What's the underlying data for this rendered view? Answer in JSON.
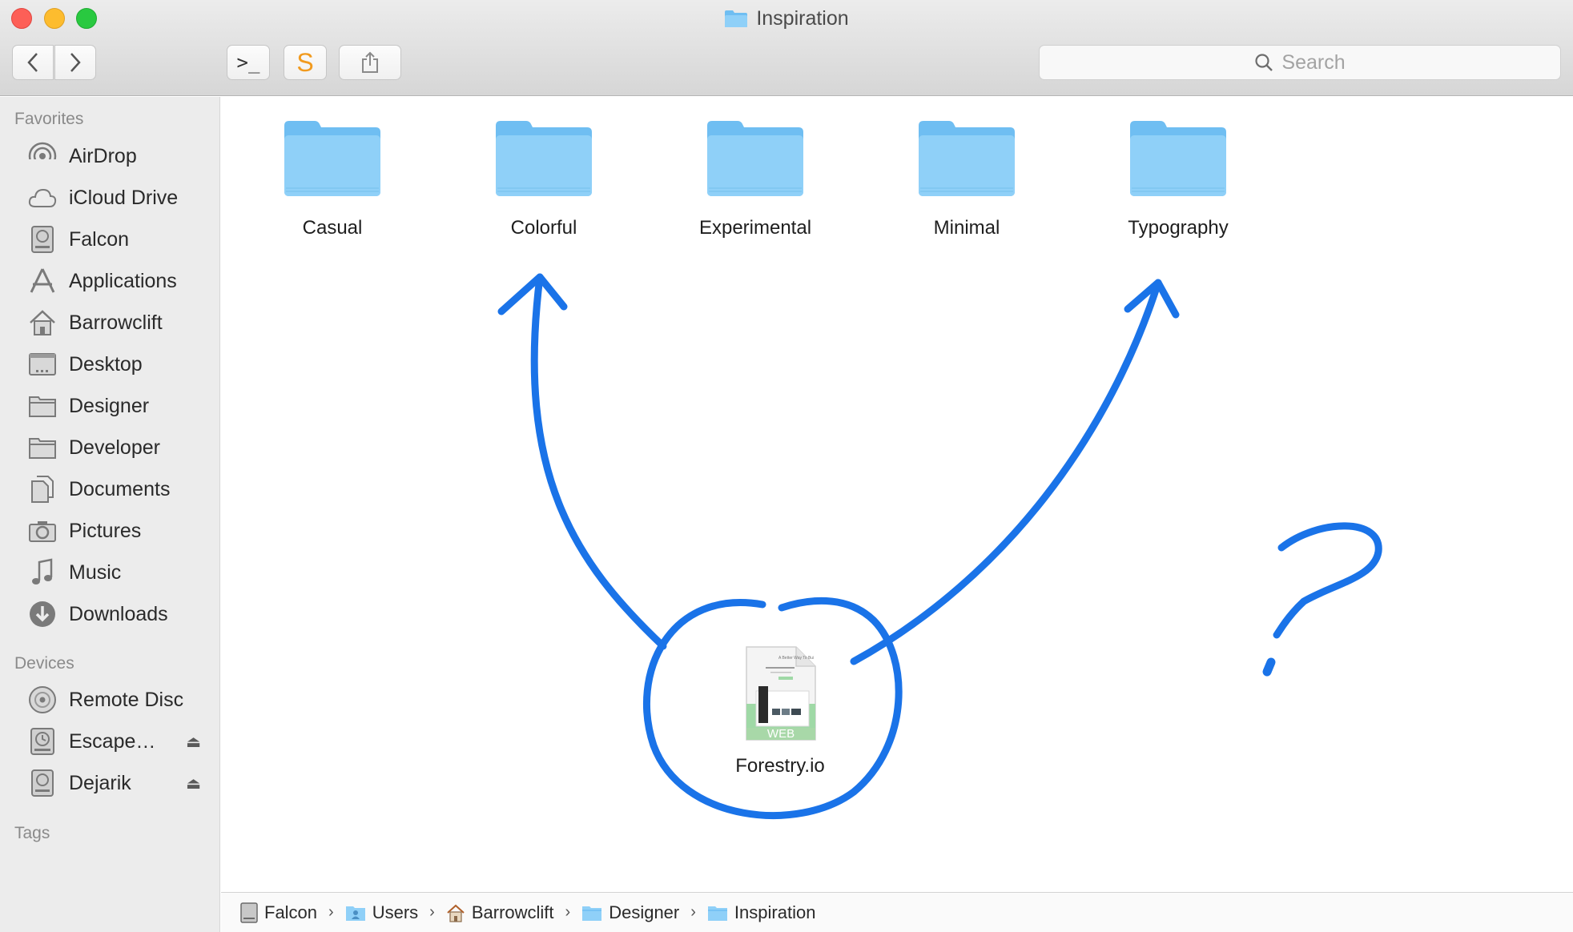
{
  "window": {
    "title": "Inspiration"
  },
  "toolbar": {
    "back_label": "‹",
    "forward_label": "›",
    "terminal_label": ">_",
    "sublime_label": "S",
    "search_placeholder": "Search"
  },
  "sidebar": {
    "favorites_heading": "Favorites",
    "favorites": [
      {
        "label": "AirDrop",
        "icon": "airdrop-icon"
      },
      {
        "label": "iCloud Drive",
        "icon": "cloud-icon"
      },
      {
        "label": "Falcon",
        "icon": "hard-drive-icon"
      },
      {
        "label": "Applications",
        "icon": "applications-icon"
      },
      {
        "label": "Barrowclift",
        "icon": "home-icon"
      },
      {
        "label": "Desktop",
        "icon": "desktop-icon"
      },
      {
        "label": "Designer",
        "icon": "folder-icon"
      },
      {
        "label": "Developer",
        "icon": "folder-icon"
      },
      {
        "label": "Documents",
        "icon": "documents-icon"
      },
      {
        "label": "Pictures",
        "icon": "camera-icon"
      },
      {
        "label": "Music",
        "icon": "music-note-icon"
      },
      {
        "label": "Downloads",
        "icon": "download-icon"
      }
    ],
    "devices_heading": "Devices",
    "devices": [
      {
        "label": "Remote Disc",
        "icon": "disc-icon"
      },
      {
        "label": "Escape…",
        "icon": "time-machine-icon",
        "eject": "⏏"
      },
      {
        "label": "Dejarik",
        "icon": "hard-drive-icon",
        "eject": "⏏"
      }
    ],
    "tags_heading": "Tags"
  },
  "content": {
    "folders": [
      {
        "label": "Casual"
      },
      {
        "label": "Colorful"
      },
      {
        "label": "Experimental"
      },
      {
        "label": "Minimal"
      },
      {
        "label": "Typography"
      }
    ],
    "file": {
      "label": "Forestry.io",
      "badge": "WEB",
      "thumb_heading": "A Better Way To Bui"
    }
  },
  "pathbar": {
    "items": [
      {
        "label": "Falcon",
        "icon": "hard-drive-icon"
      },
      {
        "label": "Users",
        "icon": "users-folder-icon"
      },
      {
        "label": "Barrowclift",
        "icon": "home-icon"
      },
      {
        "label": "Designer",
        "icon": "folder-icon"
      },
      {
        "label": "Inspiration",
        "icon": "folder-icon"
      }
    ],
    "separator": "›"
  },
  "colors": {
    "annotation_blue": "#1a73e8",
    "folder_blue": "#8fd0f8",
    "close": "#fd5f57",
    "minimize": "#fdbc2e",
    "maximize": "#29c940"
  }
}
